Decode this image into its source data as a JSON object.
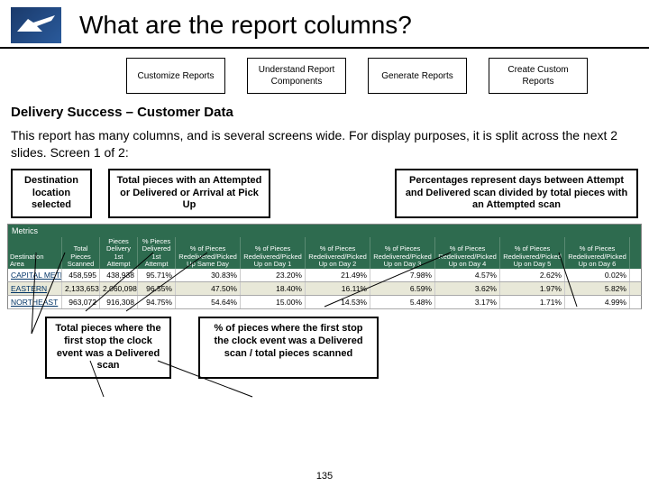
{
  "header": {
    "title": "What are the report columns?"
  },
  "tabs": {
    "customize": "Customize Reports",
    "understand": "Understand Report Components",
    "generate": "Generate Reports",
    "custom": "Create Custom Reports"
  },
  "section_title": "Delivery Success – Customer Data",
  "intro": "This report has many columns, and is several screens wide.  For display purposes, it is split across the next 2 slides.  Screen 1 of 2:",
  "callouts": {
    "dest": "Destination location selected",
    "total_att": "Total pieces with an Attempted or Delivered or Arrival at Pick Up",
    "pct": "Percentages represent days between Attempt and Delivered scan divided by total pieces with an Attempted scan",
    "deliv": "Total pieces where the first stop the clock event was a Delivered scan",
    "stc": "% of pieces where the first stop the clock event was a Delivered scan / total pieces scanned"
  },
  "table": {
    "metrics_label": "Metrics",
    "headers": {
      "dest": "Destination Area",
      "tps": "Total Pieces Scanned",
      "d1a": "Pieces Delivery 1st Attempt",
      "pd1a": "% Pieces Delivered 1st Attempt",
      "same": "% of Pieces Redelivered/Picked Up Same Day",
      "d1": "% of Pieces Redelivered/Picked Up on Day 1",
      "d2": "% of Pieces Redelivered/Picked Up on Day 2",
      "d3": "% of Pieces Redelivered/Picked Up on Day 3",
      "d4": "% of Pieces Redelivered/Picked Up on Day 4",
      "d5": "% of Pieces Redelivered/Picked Up on Day 5",
      "d6": "% of Pieces Redelivered/Picked Up on Day 6"
    },
    "rows": [
      {
        "dest": "CAPITAL METRO",
        "tps": "458,595",
        "d1a": "438,938",
        "pd1a": "95.71%",
        "same": "30.83%",
        "d1": "23.20%",
        "d2": "21.49%",
        "d3": "7.98%",
        "d4": "4.57%",
        "d5": "2.62%",
        "d6": "0.02%"
      },
      {
        "dest": "EASTERN",
        "tps": "2,133,653",
        "d1a": "2,060,098",
        "pd1a": "96.55%",
        "same": "47.50%",
        "d1": "18.40%",
        "d2": "16.11%",
        "d3": "6.59%",
        "d4": "3.62%",
        "d5": "1.97%",
        "d6": "5.82%"
      },
      {
        "dest": "NORTHEAST",
        "tps": "963,072",
        "d1a": "916,308",
        "pd1a": "94.75%",
        "same": "54.64%",
        "d1": "15.00%",
        "d2": "14.53%",
        "d3": "5.48%",
        "d4": "3.17%",
        "d5": "1.71%",
        "d6": "4.99%"
      }
    ]
  },
  "page_num": "135"
}
